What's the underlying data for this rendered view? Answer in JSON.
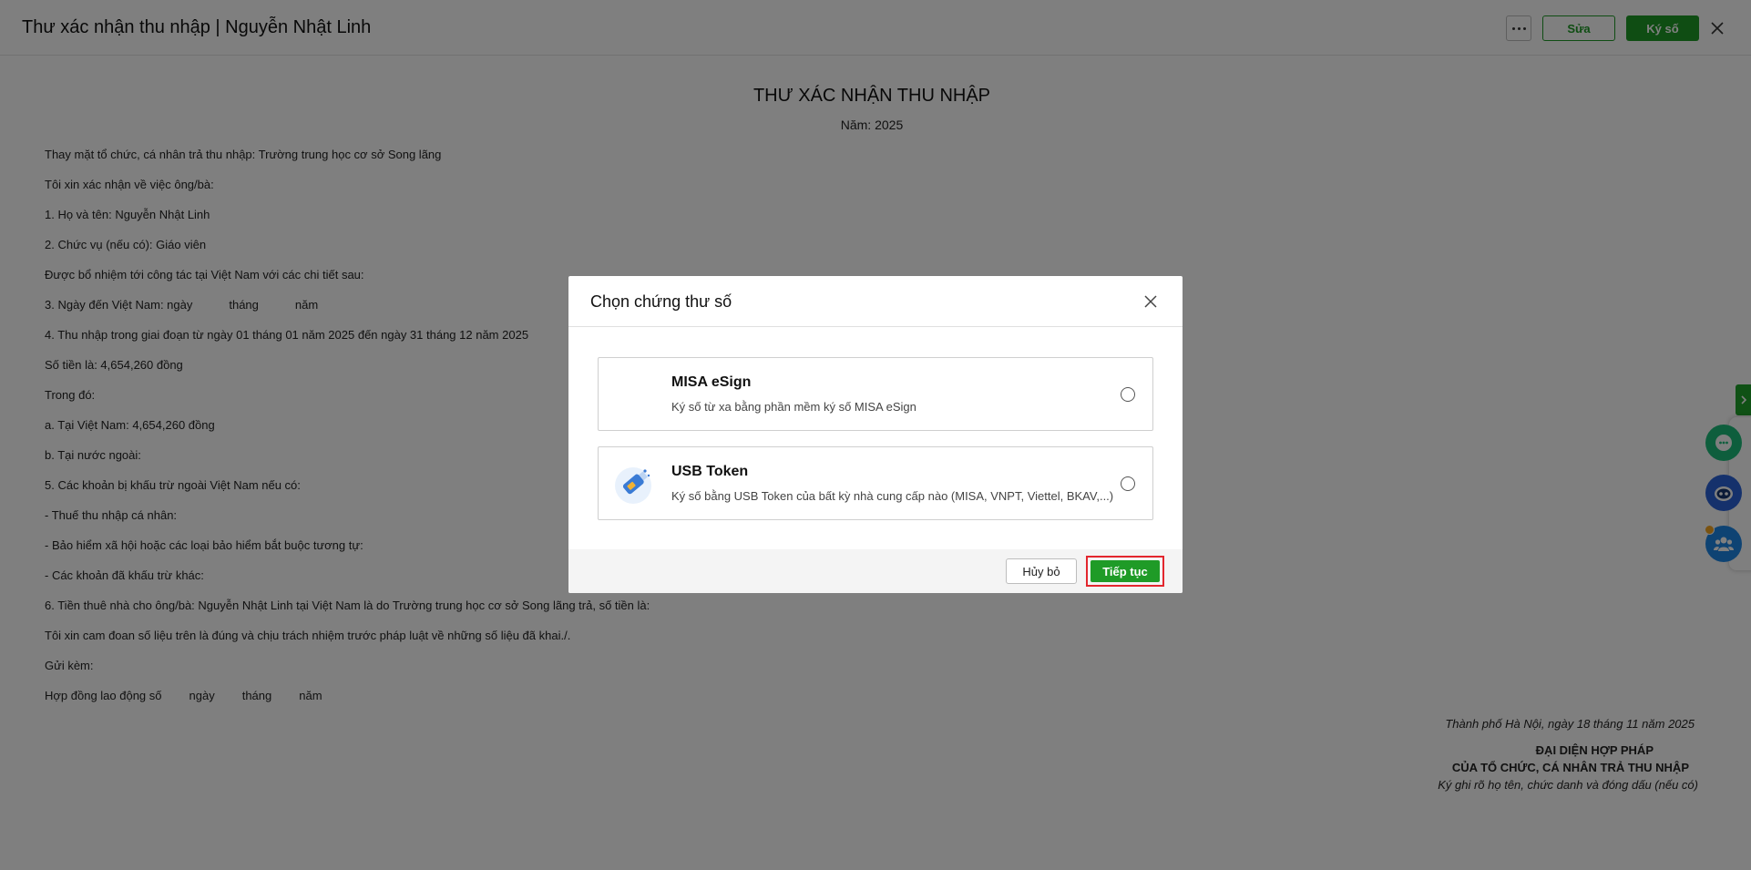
{
  "header": {
    "title": "Thư xác nhận thu nhập | Nguyễn Nhật Linh",
    "edit_label": "Sửa",
    "sign_label": "Ký số"
  },
  "document": {
    "title": "THƯ XÁC NHẬN THU NHẬP",
    "year": "Năm: 2025",
    "lines": [
      "Thay mặt tổ chức, cá nhân trả thu nhập: Trường trung học cơ sở Song lãng",
      "Tôi xin xác nhận về việc ông/bà:",
      "1. Họ và tên: Nguyễn Nhật Linh",
      "2. Chức vụ (nếu có): Giáo viên",
      "Được bổ nhiệm tới công tác tại Việt Nam với các chi tiết sau:",
      "4. Thu nhập trong giai đoạn từ ngày 01 tháng 01 năm 2025 đến ngày 31 tháng 12 năm 2025",
      "Số tiền là: 4,654,260 đồng",
      "Trong đó:",
      "a. Tại Việt Nam: 4,654,260 đồng",
      "b. Tại nước ngoài:",
      "5. Các khoản bị khấu trừ ngoài Việt Nam nếu có:",
      "- Thuế thu nhập cá nhân:",
      "- Bảo hiểm xã hội hoặc các loại bảo hiểm bắt buộc tương tự:",
      "- Các khoản đã khấu trừ khác:",
      "6. Tiền thuê nhà cho ông/bà: Nguyễn Nhật Linh tại Việt Nam là do Trường trung học cơ sở Song lãng trả, số tiền là:",
      "Tôi xin cam đoan số liệu trên là đúng và chịu trách nhiệm trước pháp luật về những số liệu đã khai./.",
      "Gửi kèm:"
    ],
    "arrival": {
      "prefix": "3. Ngày đến Việt Nam: ngày",
      "month": "tháng",
      "year": "năm"
    },
    "contract": {
      "prefix": "Hợp đồng lao động số",
      "day": "ngày",
      "month": "tháng",
      "year": "năm"
    },
    "signature": {
      "place_date": "Thành phố Hà Nội, ngày 18 tháng 11 năm 2025",
      "rep_line1": "ĐẠI DIỆN HỢP PHÁP",
      "rep_line2": "CỦA TỔ CHỨC, CÁ NHÂN TRẢ THU NHẬP",
      "note": "Ký ghi rõ họ tên, chức danh và đóng dấu (nếu có)"
    }
  },
  "modal": {
    "title": "Chọn chứng thư số",
    "options": [
      {
        "title": "MISA eSign",
        "description": "Ký số từ xa bằng phần mềm ký số MISA eSign",
        "selected": false
      },
      {
        "title": "USB Token",
        "description": "Ký số bằng USB Token của bất kỳ nhà cung cấp nào (MISA, VNPT, Viettel, BKAV,...)",
        "icon": "usb-token-icon",
        "selected": false
      }
    ],
    "cancel_label": "Hủy bỏ",
    "continue_label": "Tiếp tục"
  },
  "colors": {
    "primary_green": "#1f9b27",
    "highlight_red": "#e3262e",
    "overlay": "rgba(0,0,0,0.5)"
  }
}
